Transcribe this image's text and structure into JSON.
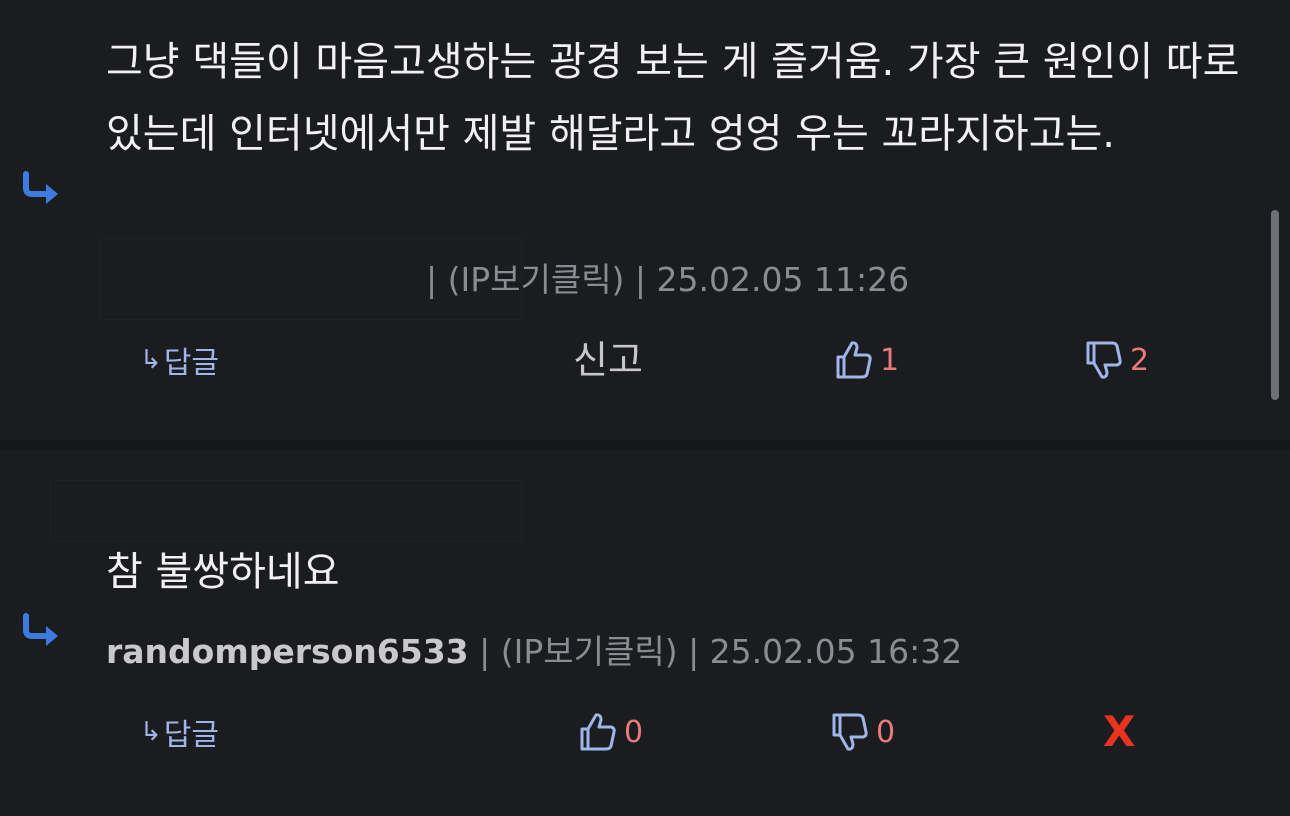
{
  "comments": [
    {
      "text": "그냥 댁들이 마음고생하는 광경 보는 게 즐거움. 가장 큰 원인이 따로 있는데 인터넷에서만 제발 해달라고 엉엉 우는 꼬라지하고는.",
      "author": "",
      "meta": "| (IP보기클릭) | 25.02.05 11:26",
      "reply_label": "답글",
      "reply_glyph": "↳",
      "report_label": "신고",
      "like_count": "1",
      "dislike_count": "2"
    },
    {
      "text": "참 불쌍하네요",
      "author": "randomperson6533",
      "meta": " | (IP보기클릭) | 25.02.05 16:32",
      "reply_label": "답글",
      "reply_glyph": "↳",
      "delete_label": "X",
      "like_count": "0",
      "dislike_count": "0"
    }
  ],
  "icons": {
    "reply_arrow": "reply-arrow-icon",
    "like": "thumbs-up-icon",
    "dislike": "thumbs-down-icon"
  },
  "colors": {
    "background": "#1b1c20",
    "reply_arrow": "#3d7be0",
    "vote_icon": "#9fb6e8",
    "vote_count": "#e87a7a",
    "delete": "#e8341f"
  }
}
